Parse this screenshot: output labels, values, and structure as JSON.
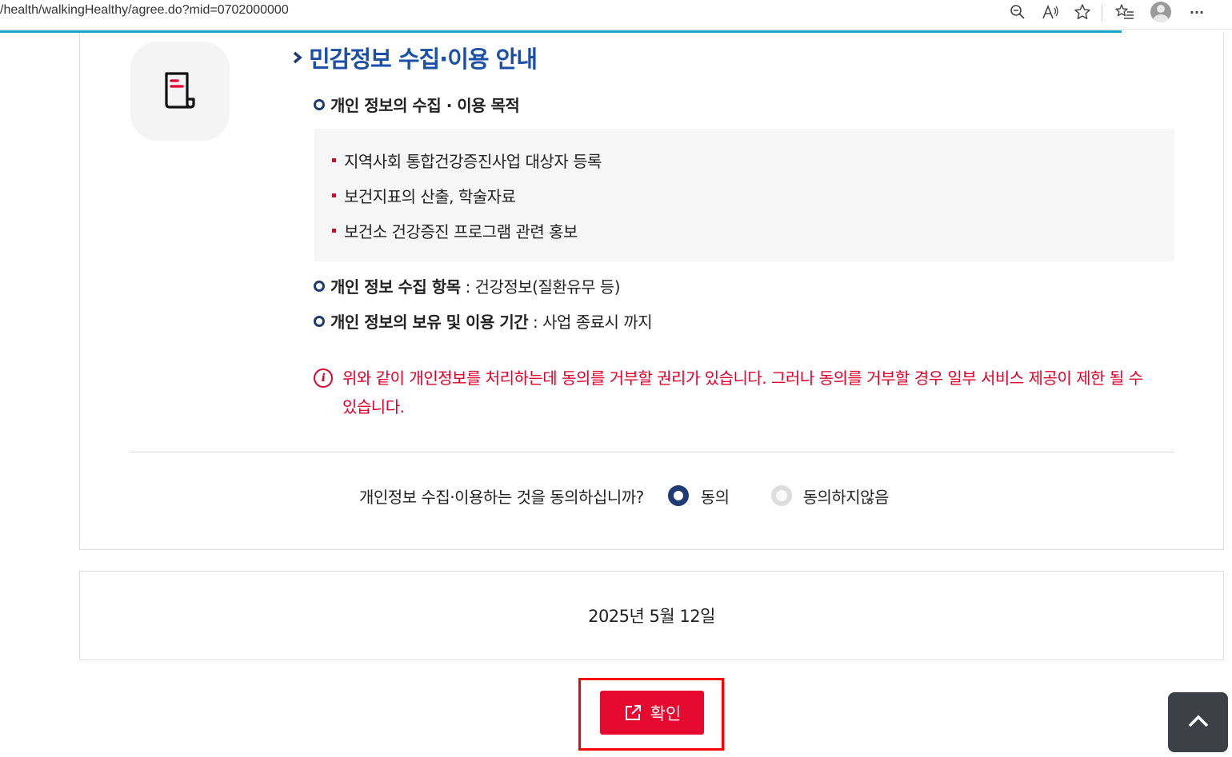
{
  "browser": {
    "url": "/health/walkingHealthy/agree.do?mid=0702000000",
    "icons": [
      "zoom-icon",
      "read-aloud-icon",
      "favorite-star-icon",
      "favorites-list-icon",
      "profile-avatar-icon",
      "more-menu-icon"
    ],
    "more_label": "···"
  },
  "section": {
    "title": "민감정보 수집·이용 안내",
    "purpose_heading": "개인 정보의 수집 · 이용 목적",
    "purposes": [
      "지역사회 통합건강증진사업 대상자 등록",
      "보건지표의 산출, 학술자료",
      "보건소 건강증진 프로그램 관련 홍보"
    ],
    "items_label": "개인 정보 수집 항목",
    "items_value": " : 건강정보(질환유무 등)",
    "period_label": "개인 정보의 보유 및 이용 기간",
    "period_value": " : 사업 종료시 까지",
    "notice": "위와 같이 개인정보를 처리하는데 동의를 거부할 권리가 있습니다. 그러나 동의를 거부할 경우 일부 서비스 제공이 제한 될 수 있습니다."
  },
  "consent": {
    "question": "개인정보 수집·이용하는 것을 동의하십니까?",
    "agree_label": "동의",
    "disagree_label": "동의하지않음",
    "selected": "agree"
  },
  "date": "2025년 5월 12일",
  "confirm_label": "확인",
  "colors": {
    "accent_red": "#e60a30",
    "navy": "#1f3b73",
    "title_blue": "#1a50a8"
  }
}
